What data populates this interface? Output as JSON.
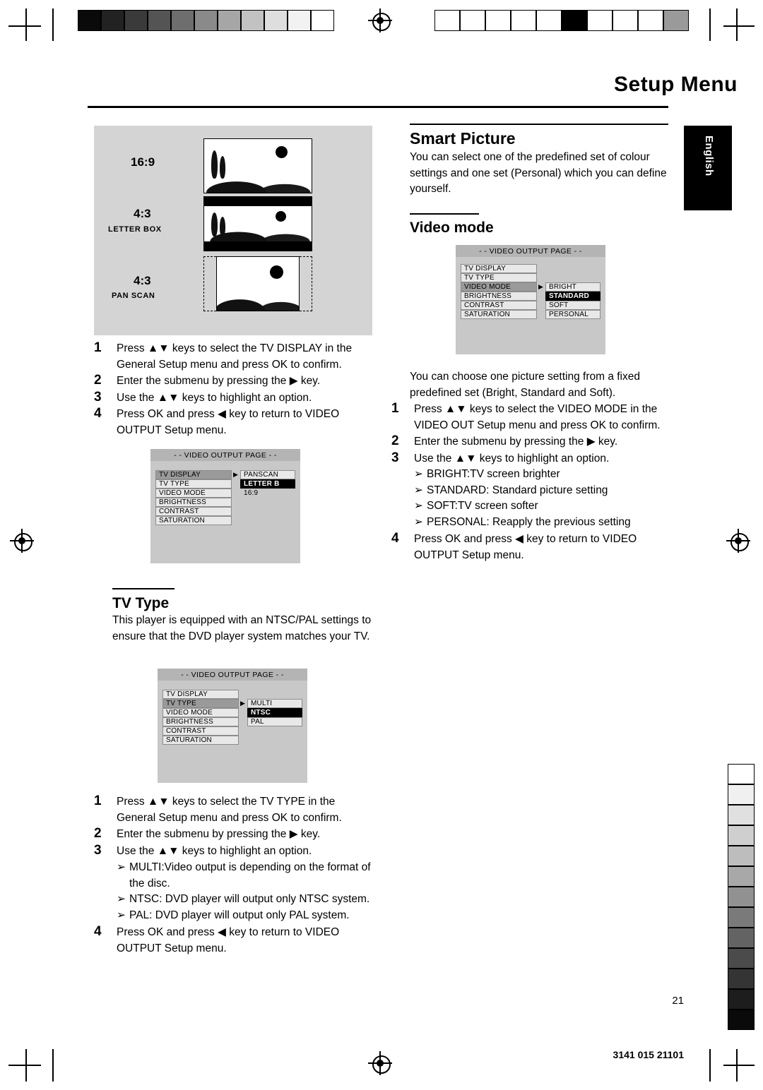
{
  "page": {
    "title": "Setup Menu",
    "language_tab": "English",
    "page_number": "21",
    "footer_code": "3141 015 21101"
  },
  "illustration": {
    "ratio_1": "16:9",
    "ratio_2": "4:3",
    "ratio_2_sub": "LETTER BOX",
    "ratio_3": "4:3",
    "ratio_3_sub": "PAN SCAN"
  },
  "tv_display_steps": [
    {
      "n": "1",
      "text": "Press ▲▼ keys to select the TV DISPLAY in the General Setup menu and press OK to confirm."
    },
    {
      "n": "2",
      "text": "Enter the submenu by pressing the ▶ key."
    },
    {
      "n": "3",
      "text": "Use the ▲▼ keys to highlight an option."
    },
    {
      "n": "4",
      "text": "Press OK and press ◀ key to return to VIDEO OUTPUT Setup menu."
    }
  ],
  "osd_tv_display": {
    "header": "- -  VIDEO OUTPUT PAGE  - -",
    "left_rows": [
      "TV DISPLAY",
      "TV TYPE",
      "VIDEO MODE",
      "BRIGHTNESS",
      "CONTRAST",
      "SATURATION"
    ],
    "right_rows": [
      "PANSCAN",
      "LETTER B",
      "16:9"
    ],
    "selected_right": "LETTER B",
    "highlighted_left": "TV DISPLAY"
  },
  "tv_type": {
    "heading": "TV Type",
    "paragraph": "This player is equipped with an NTSC/PAL settings to ensure that the DVD player system matches your TV.",
    "osd": {
      "header": "- -  VIDEO OUTPUT PAGE  - -",
      "left_rows": [
        "TV DISPLAY",
        "TV TYPE",
        "VIDEO MODE",
        "BRIGHTNESS",
        "CONTRAST",
        "SATURATION"
      ],
      "right_rows": [
        "MULTI",
        "NTSC",
        "PAL"
      ],
      "selected_right": "NTSC",
      "highlighted_left": "TV TYPE"
    },
    "steps": [
      {
        "n": "1",
        "text": "Press ▲▼ keys to select the TV TYPE in the General Setup menu and press OK to confirm."
      },
      {
        "n": "2",
        "text": "Enter the submenu by pressing the ▶ key."
      },
      {
        "n": "3",
        "text": "Use the ▲▼ keys to highlight an option."
      },
      {
        "n": "4",
        "text": "Press OK and press ◀ key to return to VIDEO OUTPUT Setup menu."
      }
    ],
    "bullets": [
      "MULTI:Video output is depending on the format of the disc.",
      "NTSC: DVD player will output only NTSC system.",
      "PAL: DVD player will output only PAL system."
    ]
  },
  "smart_picture": {
    "heading": "Smart Picture",
    "paragraph": "You can select one of the predefined set of colour settings and one set (Personal) which you can define yourself."
  },
  "video_mode": {
    "heading": "Video mode",
    "osd": {
      "header": "- -  VIDEO OUTPUT PAGE  - -",
      "left_rows": [
        "TV DISPLAY",
        "TV TYPE",
        "VIDEO MODE",
        "BRIGHTNESS",
        "CONTRAST",
        "SATURATION"
      ],
      "right_rows": [
        "BRIGHT",
        "STANDARD",
        "SOFT",
        "PERSONAL"
      ],
      "selected_right": "STANDARD",
      "highlighted_left": "VIDEO MODE"
    },
    "paragraph": "You can choose one picture setting from a fixed predefined set (Bright, Standard and Soft).",
    "steps": [
      {
        "n": "1",
        "text": "Press ▲▼ keys to select the VIDEO MODE in the VIDEO OUT Setup menu and press OK to confirm."
      },
      {
        "n": "2",
        "text": "Enter the submenu by pressing the ▶ key."
      },
      {
        "n": "3",
        "text": "Use the ▲▼ keys to highlight an option."
      },
      {
        "n": "4",
        "text": "Press OK and press ◀ key to return to VIDEO OUTPUT Setup menu."
      }
    ],
    "bullets": [
      "BRIGHT:TV screen brighter",
      "STANDARD: Standard picture setting",
      "SOFT:TV screen softer",
      "PERSONAL: Reapply the previous setting"
    ]
  },
  "colors": {
    "osd_bg": "#c8c8c8",
    "osd_header": "#b4b4b4",
    "osd_row": "#e8e8e8",
    "selected": "#000000",
    "illustration_bg": "#d4d4d4"
  },
  "calibration": {
    "top_left_steps": [
      "#0a0a0a",
      "#222222",
      "#3a3a3a",
      "#545454",
      "#6e6e6e",
      "#8a8a8a",
      "#a6a6a6",
      "#c2c2c2",
      "#dedede",
      "#f2f2f2",
      "#ffffff"
    ],
    "top_right_steps": [
      "#ffffff",
      "#ffffff",
      "#ffffff",
      "#ffffff",
      "#ffffff",
      "#000000",
      "#ffffff",
      "#ffffff",
      "#ffffff",
      "#9a9a9a"
    ],
    "right_steps": [
      "#ffffff",
      "#f0f0f0",
      "#e0e0e0",
      "#cfcfcf",
      "#bdbdbd",
      "#a8a8a8",
      "#919191",
      "#7a7a7a",
      "#636363",
      "#4b4b4b",
      "#343434",
      "#1d1d1d",
      "#0a0a0a"
    ]
  }
}
